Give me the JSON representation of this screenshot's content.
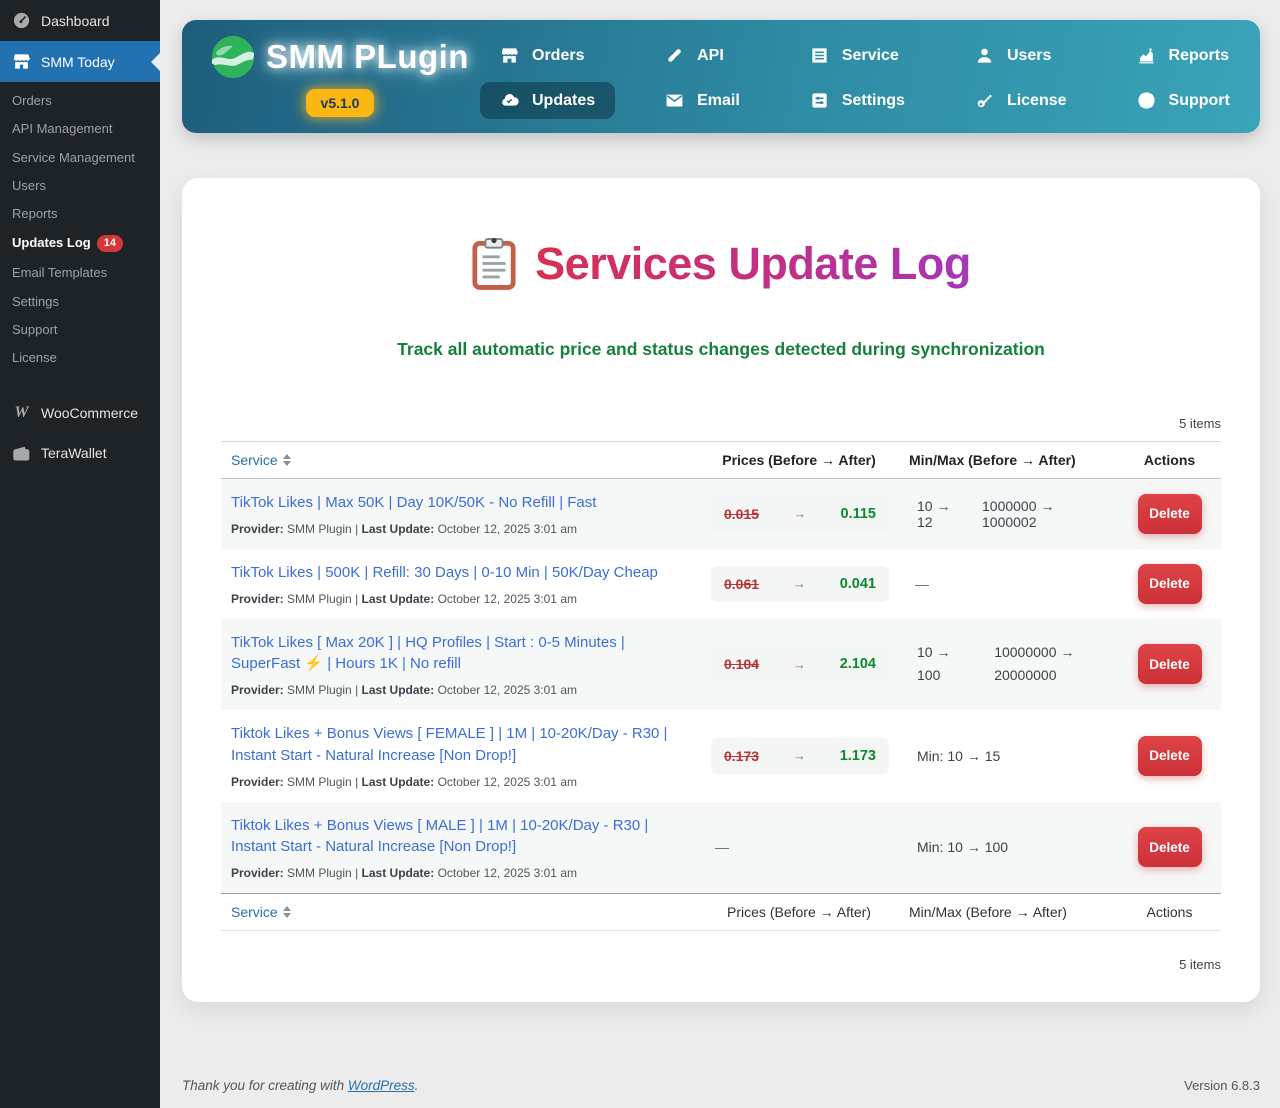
{
  "sidebar": {
    "dashboard": "Dashboard",
    "smm_today": "SMM Today",
    "submenu": {
      "orders": "Orders",
      "api": "API Management",
      "service": "Service Management",
      "users": "Users",
      "reports": "Reports",
      "updates_log": "Updates Log",
      "updates_badge": "14",
      "email": "Email Templates",
      "settings": "Settings",
      "support": "Support",
      "license": "License"
    },
    "woocommerce": "WooCommerce",
    "terawallet": "TeraWallet"
  },
  "topbar": {
    "brand": "SMM PLugin",
    "version": "v5.1.0",
    "nav": {
      "orders": "Orders",
      "api": "API",
      "service": "Service",
      "users": "Users",
      "reports": "Reports",
      "updates": "Updates",
      "email": "Email",
      "settings": "Settings",
      "license": "License",
      "support": "Support"
    }
  },
  "page": {
    "title": "Services Update Log",
    "subtitle": "Track all automatic price and status changes detected during synchronization",
    "items_count": "5 items"
  },
  "table": {
    "headers": {
      "service": "Service",
      "prices": "Prices (Before → After)",
      "minmax": "Min/Max (Before → After)",
      "actions": "Actions"
    },
    "meta": {
      "provider_label": "Provider:",
      "provider": "SMM Plugin",
      "sep": "|",
      "update_label": "Last Update:",
      "update": "October 12, 2025 3:01 am"
    },
    "arrow": "→",
    "delete_label": "Delete",
    "rows": [
      {
        "title": "TikTok Likes | Max 50K | Day 10K/50K - No Refill | Fast",
        "price_old": "0.015",
        "price_new": "0.115",
        "minmax_a": "10 → 12",
        "minmax_b": "1000000 → 1000002"
      },
      {
        "title": "TikTok Likes | 500K | Refill: 30 Days | 0-10 Min | 50K/Day Cheap",
        "price_old": "0.061",
        "price_new": "0.041",
        "minmax": "—"
      },
      {
        "title_pre": "TikTok Likes [ Max 20K ] | HQ Profiles | Start : 0-5 Minutes | SuperFast",
        "bolt": "⚡",
        "title_post": "| Hours 1K | No refill",
        "price_old": "0.104",
        "price_new": "2.104",
        "minmax_min": "10 → 100",
        "minmax_max": "10000000 → 20000000"
      },
      {
        "title": "Tiktok Likes + Bonus Views [ FEMALE ] | 1M | 10-20K/Day - R30 | Instant Start - Natural Increase [Non Drop!]",
        "price_old": "0.173",
        "price_new": "1.173",
        "minmax": "Min: 10 → 15"
      },
      {
        "title": "Tiktok Likes + Bonus Views [ MALE ] | 1M | 10-20K/Day - R30 | Instant Start - Natural Increase [Non Drop!]",
        "prices": "—",
        "minmax": "Min: 10 → 100"
      }
    ]
  },
  "footer": {
    "thanks_prefix": "Thank you for creating with",
    "wordpress": "WordPress",
    "thanks_suffix": ".",
    "version": "Version 6.8.3"
  },
  "colors": {
    "wp_blue": "#2271b1",
    "sidebar_bg": "#1d2327",
    "header_teal_dark": "#1e5d7d",
    "header_teal_light": "#3aa4b9",
    "version_gold": "#fdb714",
    "title_red": "#d93052",
    "title_purple": "#a438b8",
    "subtitle_green": "#17803e",
    "price_old_red": "#b63434",
    "price_new_green": "#0b8a2d",
    "delete_red": "#d63638",
    "badge_red": "#d63638"
  }
}
